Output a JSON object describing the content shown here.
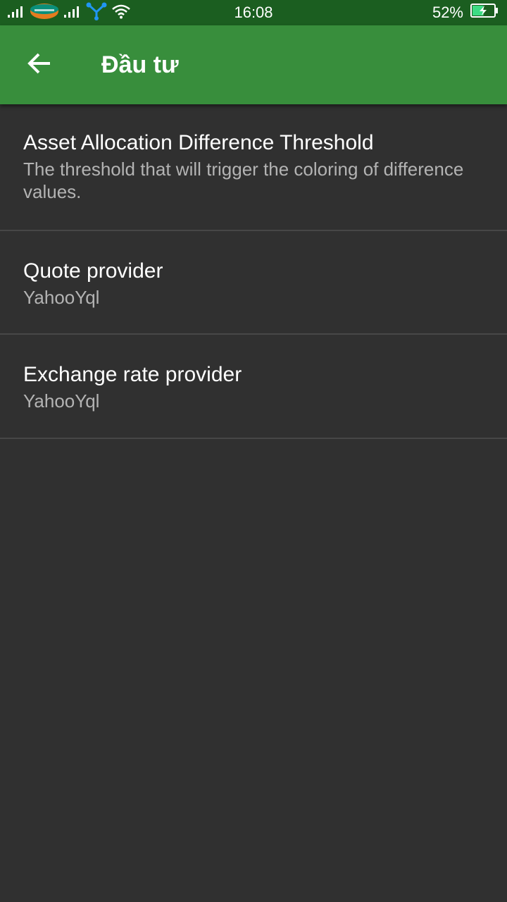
{
  "status_bar": {
    "time": "16:08",
    "battery_percent": "52%",
    "battery_level": 0.52,
    "icons": [
      "signal-icon",
      "carrier-logo-icon",
      "signal-icon",
      "data-share-icon",
      "wifi-icon",
      "battery-charging-icon"
    ]
  },
  "app_bar": {
    "title": "Đầu tư",
    "back_icon": "arrow-back-icon"
  },
  "preferences": [
    {
      "title": "Asset Allocation Difference Threshold",
      "summary": "The threshold that will trigger the coloring of difference values."
    },
    {
      "title": "Quote provider",
      "summary": "YahooYql"
    },
    {
      "title": "Exchange rate provider",
      "summary": "YahooYql"
    }
  ],
  "colors": {
    "status_bar": "#1b5e20",
    "app_bar": "#388e3c",
    "background": "#303030",
    "divider": "#474747",
    "summary_text": "#b3b3b3"
  }
}
